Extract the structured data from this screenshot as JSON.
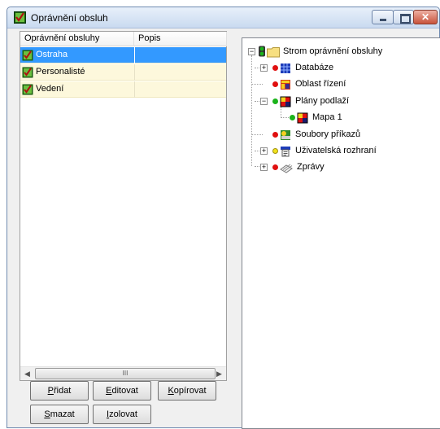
{
  "window": {
    "title": "Oprávnění obsluh",
    "icon": "check-permission-icon"
  },
  "list": {
    "columns": [
      "Oprávnění obsluhy",
      "Popis"
    ],
    "rows": [
      {
        "name": "Ostraha",
        "description": "",
        "selected": true
      },
      {
        "name": "Personalisté",
        "description": "",
        "selected": false
      },
      {
        "name": "Vedení",
        "description": "",
        "selected": false
      }
    ],
    "scroll_grip": "III"
  },
  "buttons": {
    "add": {
      "accel": "P",
      "rest": "řidat"
    },
    "edit": {
      "accel": "E",
      "rest": "ditovat"
    },
    "copy": {
      "accel": "K",
      "rest": "opírovat"
    },
    "delete": {
      "accel": "S",
      "rest": "mazat"
    },
    "isolate": {
      "accel": "I",
      "rest": "zolovat"
    }
  },
  "tree": {
    "root": "Strom oprávnění obsluhy",
    "items": [
      {
        "label": "Databáze",
        "icon": "database-grid-icon",
        "status": "red"
      },
      {
        "label": "Oblast řízení",
        "icon": "control-area-icon",
        "status": "red"
      },
      {
        "label": "Plány podlaží",
        "icon": "floor-plan-icon",
        "status": "green"
      },
      {
        "label": "Mapa 1",
        "icon": "map-icon",
        "status": "green"
      },
      {
        "label": "Soubory příkazů",
        "icon": "command-files-icon",
        "status": "red"
      },
      {
        "label": "Uživatelská rozhraní",
        "icon": "user-interface-icon",
        "status": "yellow"
      },
      {
        "label": "Zprávy",
        "icon": "messages-icon",
        "status": "red"
      }
    ]
  },
  "colors": {
    "selection": "#3399ff",
    "row_background": "#fdf8dc",
    "status_red": "#e01010",
    "status_green": "#1bb31b",
    "status_yellow": "#f0e21c"
  }
}
